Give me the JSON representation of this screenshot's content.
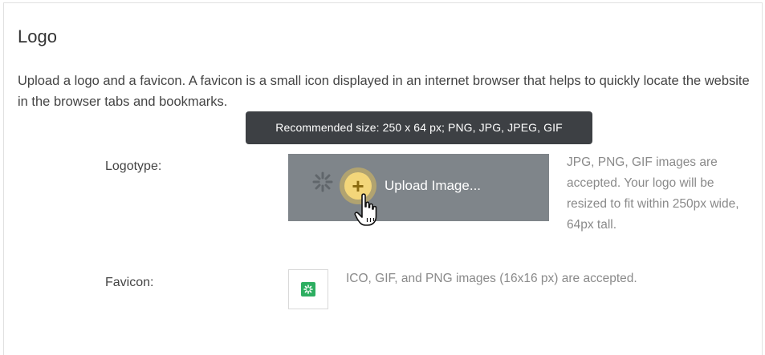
{
  "section": {
    "title": "Logo",
    "description": "Upload a logo and a favicon. A favicon is a small icon displayed in an internet browser that helps to quickly locate the website in the browser tabs and bookmarks."
  },
  "tooltip": {
    "text": "Recommended size: 250 x 64 px; PNG, JPG, JPEG, GIF"
  },
  "logotype": {
    "label": "Logotype:",
    "upload_label": "Upload Image...",
    "help": "JPG, PNG, GIF images are accepted. Your logo will be resized to fit within 250px wide, 64px tall."
  },
  "favicon": {
    "label": "Favicon:",
    "help": "ICO, GIF, and PNG images (16x16 px) are accepted."
  },
  "icons": {
    "upload": "plus-circle-icon",
    "cursor": "hand-pointer-icon",
    "favicon": "green-spark-favicon"
  },
  "colors": {
    "tooltip_bg": "#3d4044",
    "upload_overlay": "#7f858a",
    "plus_highlight": "#f3d67a",
    "favicon_green": "#2dae61"
  }
}
